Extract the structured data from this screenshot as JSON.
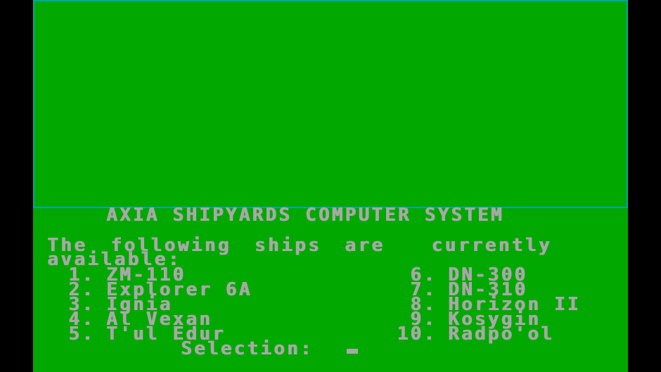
{
  "screen": {
    "title": "AXIA SHIPYARDS COMPUTER SYSTEM",
    "intro_line1": "The following ships are  currently",
    "intro_line2": "available:",
    "ships_left": [
      {
        "number": "1.",
        "name": "ZM-110"
      },
      {
        "number": "2.",
        "name": "Explorer 6A"
      },
      {
        "number": "3.",
        "name": "Ignia"
      },
      {
        "number": "4.",
        "name": "Al Vexan"
      },
      {
        "number": "5.",
        "name": "T'ul Edur"
      }
    ],
    "ships_right": [
      {
        "number": "6.",
        "name": "DN-300"
      },
      {
        "number": "7.",
        "name": "DN-310"
      },
      {
        "number": "8.",
        "name": "Horizon II"
      },
      {
        "number": "9.",
        "name": "Kosygin"
      },
      {
        "number": "10.",
        "name": "Radpo'ol"
      }
    ],
    "prompt": "Selection:"
  },
  "colors": {
    "background": "#00a800",
    "text": "#a8a8a8",
    "viewport_border": "#00a8a8",
    "letterbox": "#000000"
  }
}
